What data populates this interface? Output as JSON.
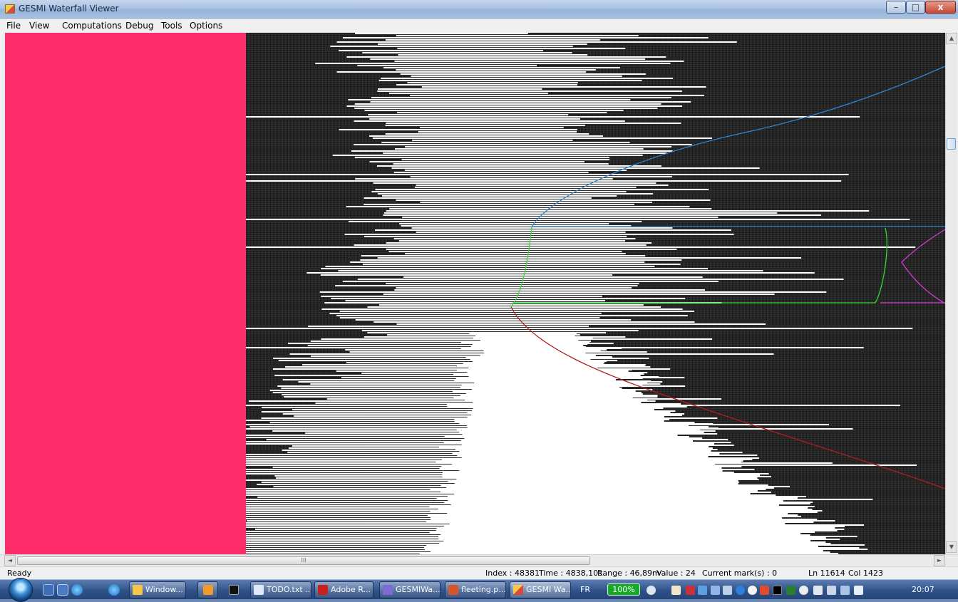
{
  "window": {
    "title": "GESMI Waterfall Viewer"
  },
  "window_controls": {
    "minimize": "–",
    "maximize": "□",
    "close": "x"
  },
  "menu": [
    "File",
    "View",
    "Computations",
    "Debug",
    "Tools",
    "Options"
  ],
  "scrollbars": {
    "up": "▲",
    "down": "▼",
    "left": "◄",
    "right": "►",
    "hthumb_grip": "III"
  },
  "status": {
    "ready": "Ready",
    "index": "Index : 48381",
    "time": "Time : 4838,10s",
    "range": "Range : 46,89m",
    "value": "Value : 24",
    "marks": "Current mark(s) : 0",
    "ln": "Ln 11614",
    "col": "Col 1423"
  },
  "taskbar": {
    "items": [
      "Window...",
      "TODO.txt ...",
      "Adobe R...",
      "GESMIWa...",
      "fleeting.p...",
      "GESMI Wa..."
    ],
    "language": "FR",
    "battery": "100%",
    "clock": "20:07"
  },
  "colors": {
    "panel": "#ff2d69",
    "curve_blue": "#2f87d8",
    "curve_green": "#2fdc2f",
    "curve_red": "#b01c1c",
    "curve_magenta": "#d43ad4"
  }
}
